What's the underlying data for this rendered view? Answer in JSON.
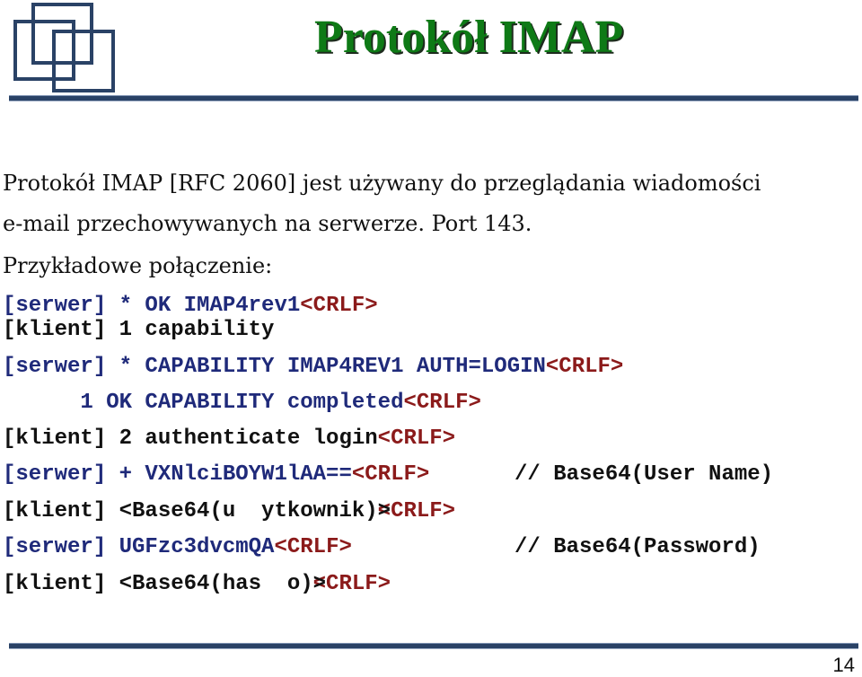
{
  "slide": {
    "title": "Protokół IMAP",
    "page_number": "14",
    "logo_icon": "overlapping-squares-logo",
    "colors": {
      "title": "#0e7a16",
      "server": "#1f2a7a",
      "crlf": "#8b1a1a",
      "client": "#111111",
      "rule": "#2a4266"
    }
  },
  "intro": {
    "line1": "Protokół IMAP [RFC 2060] jest używany do przeglądania wiadomości",
    "line2": "e-mail przechowywanych na serwerze. Port 143.",
    "line3": "Przykładowe połączenie:"
  },
  "session": [
    {
      "who": "[serwer]",
      "text": " * OK IMAP4rev1",
      "crlf": "<CRLF>"
    },
    {
      "who": "[klient]",
      "text": " 1 capability",
      "crlf": ""
    },
    {
      "who": "[serwer]",
      "text": " * CAPABILITY IMAP4REV1 AUTH=LOGIN",
      "crlf": "<CRLF>"
    },
    {
      "who": "",
      "text": "      1 OK CAPABILITY completed",
      "crlf": "<CRLF>"
    },
    {
      "who": "[klient]",
      "text": " 2 authenticate login",
      "crlf": "<CRLF>"
    },
    {
      "who": "[serwer]",
      "text": " + VXNlciBOYW1lAA==",
      "crlf": "<CRLF>",
      "comment": "// Base64(User Name)"
    },
    {
      "who": "[klient]",
      "text": " <Base64(u  ytkownik)",
      "overlap_gt": ">",
      "overlap_lt": "<",
      "crlf": "CRLF>"
    },
    {
      "who": "[serwer]",
      "text": " UGFzc3dvcmQA",
      "crlf": "<CRLF>",
      "comment": "// Base64(Password)"
    },
    {
      "who": "[klient]",
      "text": " <Base64(has  o)",
      "overlap_gt": ">",
      "overlap_lt": "<",
      "crlf": "CRLF>"
    }
  ]
}
